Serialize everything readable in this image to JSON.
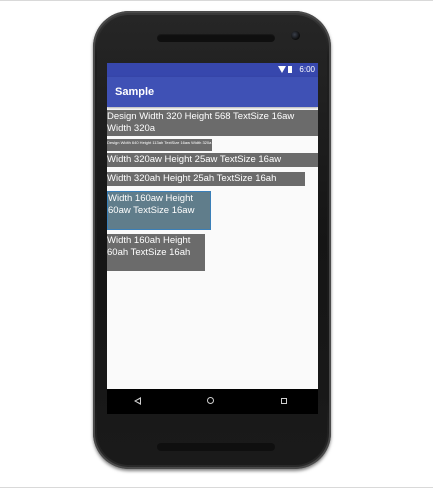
{
  "status_bar": {
    "time": "6:00",
    "icons": [
      "wifi-icon",
      "battery-icon"
    ],
    "color": "#3747ad"
  },
  "app_bar": {
    "title": "Sample",
    "color": "#3f51b5"
  },
  "boxes": [
    {
      "text": "Design Width 320  Height 568 TextSize 16aw Width 320a"
    },
    {
      "text": "Design Width 640  Height 113ah TextSize 16aw Width 320a"
    },
    {
      "text": "Width 320aw  Height 25aw TextSize 16aw"
    },
    {
      "text": "Width 320ah  Height 25ah TextSize 16ah"
    },
    {
      "text": "Width 160aw  Height 60aw TextSize 16aw"
    },
    {
      "text": "Width 160ah  Height 60ah TextSize 16ah"
    }
  ],
  "nav_bar": {
    "icons": [
      "back-icon",
      "home-icon",
      "recent-apps-icon"
    ]
  },
  "colors": {
    "box_background": "#6b6b6b",
    "selected_box_background": "#607d8b",
    "selected_box_border": "#3a7fb8"
  }
}
